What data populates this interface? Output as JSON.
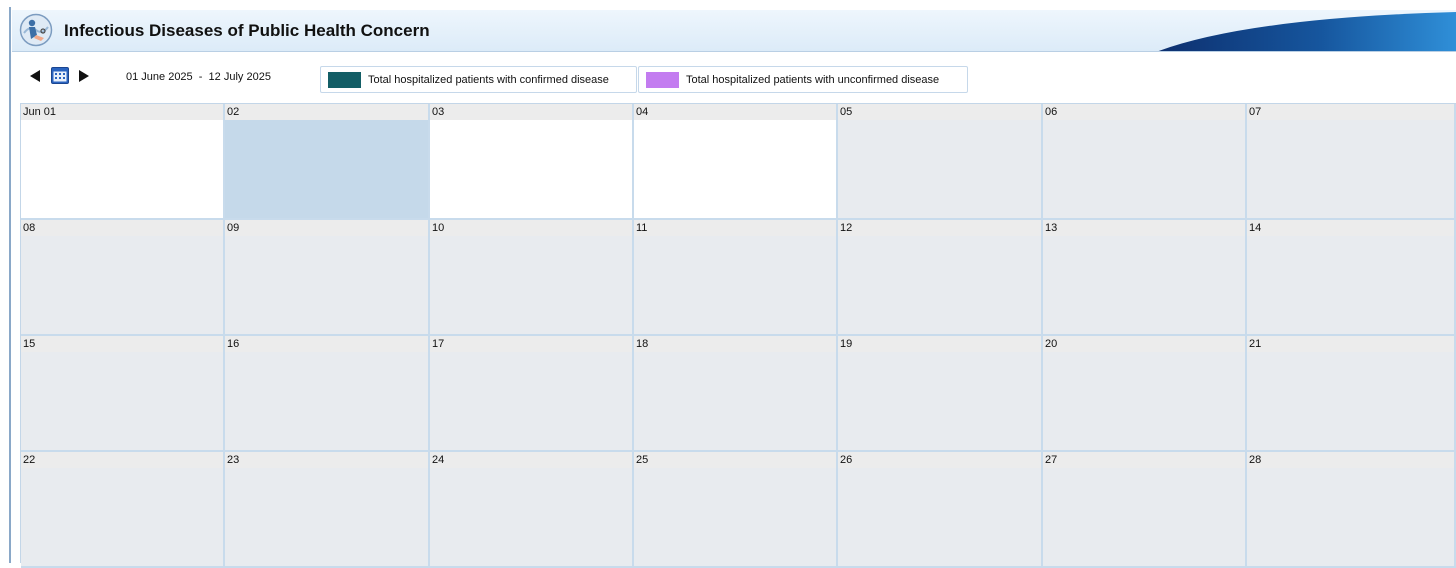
{
  "header": {
    "title": "Infectious Diseases of Public Health Concern"
  },
  "toolbar": {
    "date_range": "01 June 2025  -  12 July 2025",
    "legend": [
      {
        "label": "Total hospitalized patients with confirmed disease",
        "color": "#135e66"
      },
      {
        "label": "Total hospitalized patients with unconfirmed disease",
        "color": "#c37cf0"
      }
    ]
  },
  "colors": {
    "header_bg": "#e3eff9",
    "cell_default": "#e8ebef",
    "cell_current": "#ffffff",
    "cell_selected": "#c5d9ea",
    "grid_line": "#c8dbec"
  },
  "calendar": {
    "weeks": [
      [
        {
          "label": "Jun 01",
          "state": "current"
        },
        {
          "label": "02",
          "state": "selected"
        },
        {
          "label": "03",
          "state": "current"
        },
        {
          "label": "04",
          "state": "current"
        },
        {
          "label": "05",
          "state": "other"
        },
        {
          "label": "06",
          "state": "other"
        },
        {
          "label": "07",
          "state": "other"
        }
      ],
      [
        {
          "label": "08",
          "state": "other"
        },
        {
          "label": "09",
          "state": "other"
        },
        {
          "label": "10",
          "state": "other"
        },
        {
          "label": "11",
          "state": "other"
        },
        {
          "label": "12",
          "state": "other"
        },
        {
          "label": "13",
          "state": "other"
        },
        {
          "label": "14",
          "state": "other"
        }
      ],
      [
        {
          "label": "15",
          "state": "other"
        },
        {
          "label": "16",
          "state": "other"
        },
        {
          "label": "17",
          "state": "other"
        },
        {
          "label": "18",
          "state": "other"
        },
        {
          "label": "19",
          "state": "other"
        },
        {
          "label": "20",
          "state": "other"
        },
        {
          "label": "21",
          "state": "other"
        }
      ],
      [
        {
          "label": "22",
          "state": "other"
        },
        {
          "label": "23",
          "state": "other"
        },
        {
          "label": "24",
          "state": "other"
        },
        {
          "label": "25",
          "state": "other"
        },
        {
          "label": "26",
          "state": "other"
        },
        {
          "label": "27",
          "state": "other"
        },
        {
          "label": "28",
          "state": "other"
        }
      ]
    ]
  }
}
